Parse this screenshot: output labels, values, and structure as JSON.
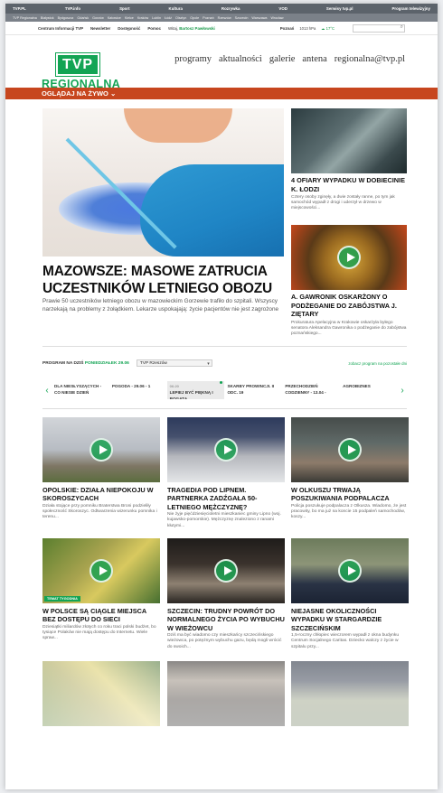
{
  "topbar": [
    "TVP.PL",
    "TVP.info",
    "Sport",
    "Kultura",
    "Rozrywka",
    "VOD",
    "Serwisy tvp.pl",
    "Program telewizyjny"
  ],
  "citybar": [
    "TVP Regionalna",
    "Białystok",
    "Bydgoszcz",
    "Gdańsk",
    "Gorzów",
    "Katowice",
    "Kielce",
    "Kraków",
    "Lublin",
    "Łódź",
    "Olsztyn",
    "Opole",
    "Poznań",
    "Rzeszów",
    "Szczecin",
    "Warszawa",
    "Wrocław"
  ],
  "infobar": {
    "links": [
      "Centrum Informacji TVP",
      "Newsletter",
      "Dostępność",
      "Pomoc"
    ],
    "hello": "Witaj,",
    "user": "Bartosz Pawłowski",
    "city": "Poznań",
    "pressure": "1013 hPa",
    "temp": "17°C",
    "search_icon": "search-icon"
  },
  "logo": {
    "box": "TVP",
    "name": "REGIONALNA"
  },
  "nav": [
    "programy",
    "aktualności",
    "galerie",
    "antena",
    "regionalna@tvp.pl"
  ],
  "live": "OGLĄDAJ NA ŻYWO ⌄",
  "hero": {
    "title": "MAZOWSZE: MASOWE ZATRUCIA UCZESTNIKÓW LETNIEGO OBOZU",
    "lead": "Prawie 50 uczestników letniego obozu w mazowieckim Gorzewie trafiło do szpitali. Wszyscy narzekają na problemy z żołądkiem. Lekarze uspokajają: życie pacjentów nie jest zagrożone"
  },
  "side": [
    {
      "title": "4 OFIARY WYPADKU W DOBIECINIE K. ŁODZI",
      "lead": "Cztery osoby zginęły, a dwie zostały ranne, po tym jak samochód wypadł z drogi i uderzył w drzewo w miejscowości..."
    },
    {
      "title": "A. GAWRONIK OSKARŻONY O PODŻEGANIE DO ZABÓJSTWA J. ZIĘTARY",
      "lead": "Prokuratura Apelacyjna w Krakowie oskarżyła byłego senatora Aleksandra Gawronika o podżeganie do zabójstwa poznańskiego..."
    }
  ],
  "program": {
    "label": "PROGRAM NA DZIŚ",
    "day": "PONIEDZIAŁEK 29.06",
    "station": "TVP Rzeszów",
    "full_link": "zobacz program na pozostałe dni",
    "items": [
      {
        "time": "",
        "title": "DLA NIESŁYSZĄCYCH - CO NIESIE DZIEŃ"
      },
      {
        "time": "",
        "title": "POGODA - 29.06 - 1"
      },
      {
        "time": "06:20",
        "title": "LEPIEJ BYĆ PIĘKNĄ I BOGATĄ"
      },
      {
        "time": "",
        "title": "SKARBY PROWINCJI. II ODC. 19"
      },
      {
        "time": "",
        "title": "PRZECHODZIEŃ CODZIENNY - 13.04 -"
      },
      {
        "time": "",
        "title": "AGROBIZNES"
      }
    ]
  },
  "cards": [
    {
      "title": "OPOLSKIE: DZIAŁA NIEPOKOJU W SKOROSZYCACH",
      "lead": "Działa stojące przy pomniku Braterstwa Broni podzieliły społeczność Skoroszyc. Odtwarzenia wizerunku pomnika i terenu...",
      "badge": ""
    },
    {
      "title": "TRAGEDIA POD LIPNEM. PARTNERKA ZADŹGAŁA 50-LETNIEGO MĘŻCZYZNĘ?",
      "lead": "Nie żyje pięćdziesięcioletni mieszkaniec gminy Lipno (woj. kujawsko-pomorskie). Mężczyznę znaleziono z ranami kłutymi...",
      "badge": ""
    },
    {
      "title": "W OLKUSZU TRWAJĄ POSZUKIWANIA PODPALACZA",
      "lead": "Policja poszukuje podpalacza z Olkusza. Wiadomo, że jest pracowity, bo ma już na koncie 15 podpaleń samochodów, koszy...",
      "badge": ""
    },
    {
      "title": "W POLSCE SĄ CIĄGLE MIEJSCA BEZ DOSTĘPU DO SIECI",
      "lead": "Dziesiątki miliardów złotych co roku traci polski budżet, bo tysiące Polaków nie mają dostępu do Internetu. Wiele spraw...",
      "badge": "TEMAT TYGODNIA"
    },
    {
      "title": "SZCZECIN: TRUDNY POWRÓT DO NORMALNEGO ŻYCIA PO WYBUCHU W WIEŻOWCU",
      "lead": "Dziś ma być wiadomo czy mieszkańcy szczecińskiego wieżowca, po potężnym wybuchu gazu, będą mogli wrócić do swoich...",
      "badge": ""
    },
    {
      "title": "NIEJASNE OKOLICZNOŚCI WYPADKU W STARGARDZIE SZCZECIŃSKIM",
      "lead": "1,5-roczny chłopiec wieczorem wypadł z okna budynku Centrum Socjalnego Caritas. Dziecko walczy z życie w szpitalu przy...",
      "badge": ""
    }
  ],
  "icons": {
    "play": "play-icon",
    "chevron_left": "chevron-left-icon",
    "chevron_right": "chevron-right-icon"
  },
  "colors": {
    "brand_green": "#13a454",
    "live_bar": "#c7461e",
    "topbar": "#5c636b"
  }
}
